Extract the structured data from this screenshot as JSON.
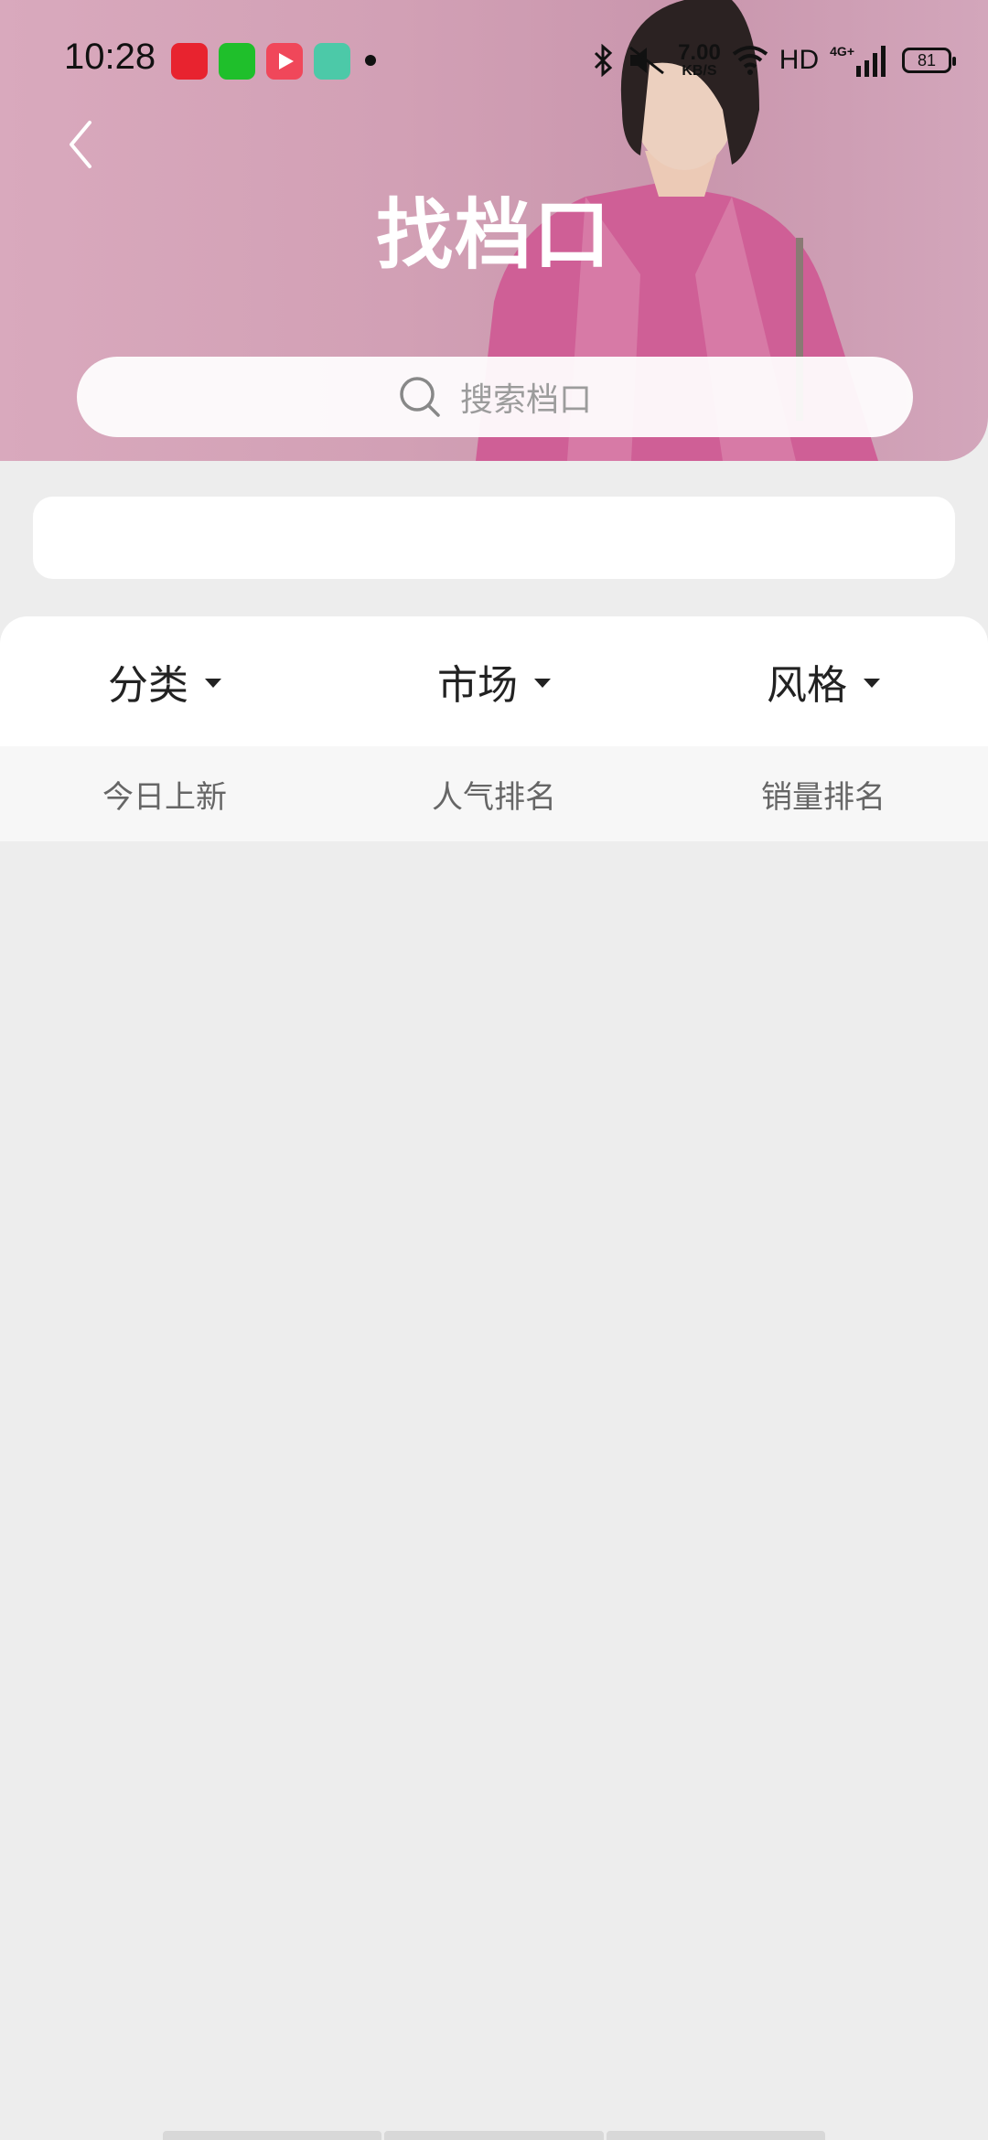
{
  "status_bar": {
    "time": "10:28",
    "net_speed_value": "7.00",
    "net_speed_unit": "KB/S",
    "hd_label": "HD",
    "signal_label": "4G+",
    "battery": "81",
    "app_icons": [
      "pinduoduo-icon",
      "iqiyi-icon",
      "video-player-icon",
      "assistant-icon"
    ]
  },
  "header": {
    "title": "找档口",
    "search_placeholder": "搜索档口"
  },
  "filters": [
    {
      "label": "分类"
    },
    {
      "label": "市场"
    },
    {
      "label": "风格"
    }
  ],
  "sort_tabs": [
    {
      "label": "今日上新"
    },
    {
      "label": "人气排名"
    },
    {
      "label": "销量排名"
    }
  ],
  "colors": {
    "header_pink": "#d2a0b5",
    "page_bg": "#ededed",
    "text_dark": "#222222",
    "text_muted": "#666666"
  }
}
